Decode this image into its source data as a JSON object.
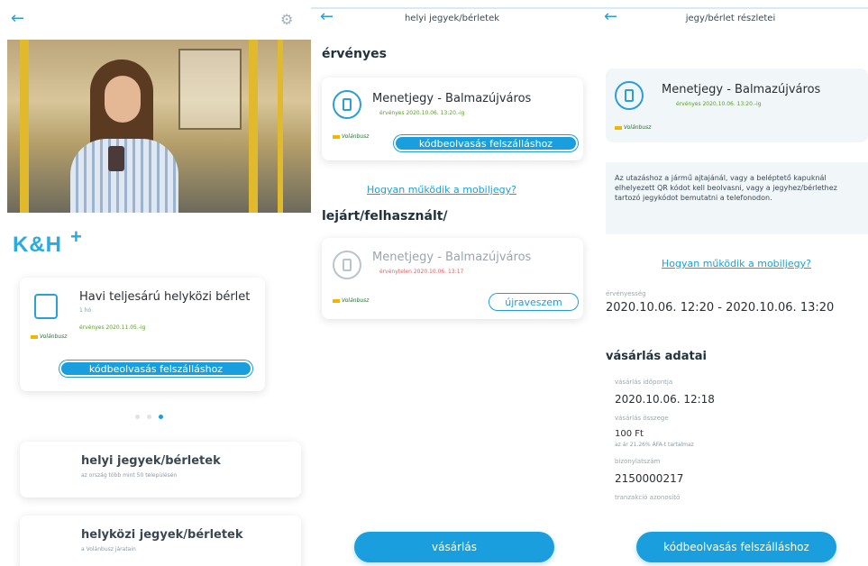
{
  "screen1": {
    "card": {
      "title": "Havi teljesárú helyközi bérlet",
      "subtitle": "1 hó",
      "validity": "érvényes 2020.11.05.-ig",
      "button": "kódbeolvasás felszálláshoz"
    },
    "logo": "K&H",
    "logo_plus": "+",
    "list": [
      {
        "title": "helyi jegyek/bérletek",
        "subtitle": "az ország több mint 50 településén"
      },
      {
        "title": "helyközi jegyek/bérletek",
        "subtitle": "a Volánbusz járatain"
      }
    ],
    "icons": {
      "back": "←",
      "settings": "⚙"
    }
  },
  "screen2": {
    "header": "helyi jegyek/bérletek",
    "valid_section": "érvényes",
    "valid_ticket": {
      "title": "Menetjegy - Balmazújváros",
      "validity": "érvényes 2020.10.06. 13:20.-ig",
      "button": "kódbeolvasás felszálláshoz"
    },
    "help_link": "Hogyan működik a mobiljegy?",
    "expired_section": "lejárt/felhasznált/",
    "expired_ticket": {
      "title": "Menetjegy - Balmazújváros",
      "validity": "érvénytelen 2020.10.06. 13:17",
      "button": "újraveszem"
    },
    "buy_button": "vásárlás"
  },
  "screen3": {
    "header": "jegy/bérlet részletei",
    "ticket": {
      "title": "Menetjegy - Balmazújváros",
      "validity": "érvényes 2020.10.06. 13:20.-ig"
    },
    "info_text": "Az utazáshoz a jármű ajtajánál, vagy a beléptető kapuknál elhelyezett QR kódot kell beolvasni, vagy a jegyhez/bérlethez tartozó jegykódot bemutatni a telefonodon.",
    "help_link": "Hogyan működik a mobiljegy?",
    "validity_label": "érvényesség",
    "validity_value": "2020.10.06. 12:20 - 2020.10.06. 13:20",
    "purchase_section": "vásárlás adatai",
    "purchase_time_label": "vásárlás időpontja",
    "purchase_time_value": "2020.10.06. 12:18",
    "amount_label": "vásárlás összege",
    "amount_value": "100 Ft",
    "amount_note": "az ár 21.26% ÁFA-t tartalmaz",
    "receipt_label": "bizonylatszám",
    "receipt_value": "2150000217",
    "transaction_label": "tranzakció azonosító",
    "scan_button": "kódbeolvasás felszálláshoz"
  },
  "brand_mini": "Volánbusz",
  "colors": {
    "accent": "#1a9ede",
    "valid": "#5a9e2b",
    "invalid": "#e35b5b"
  }
}
